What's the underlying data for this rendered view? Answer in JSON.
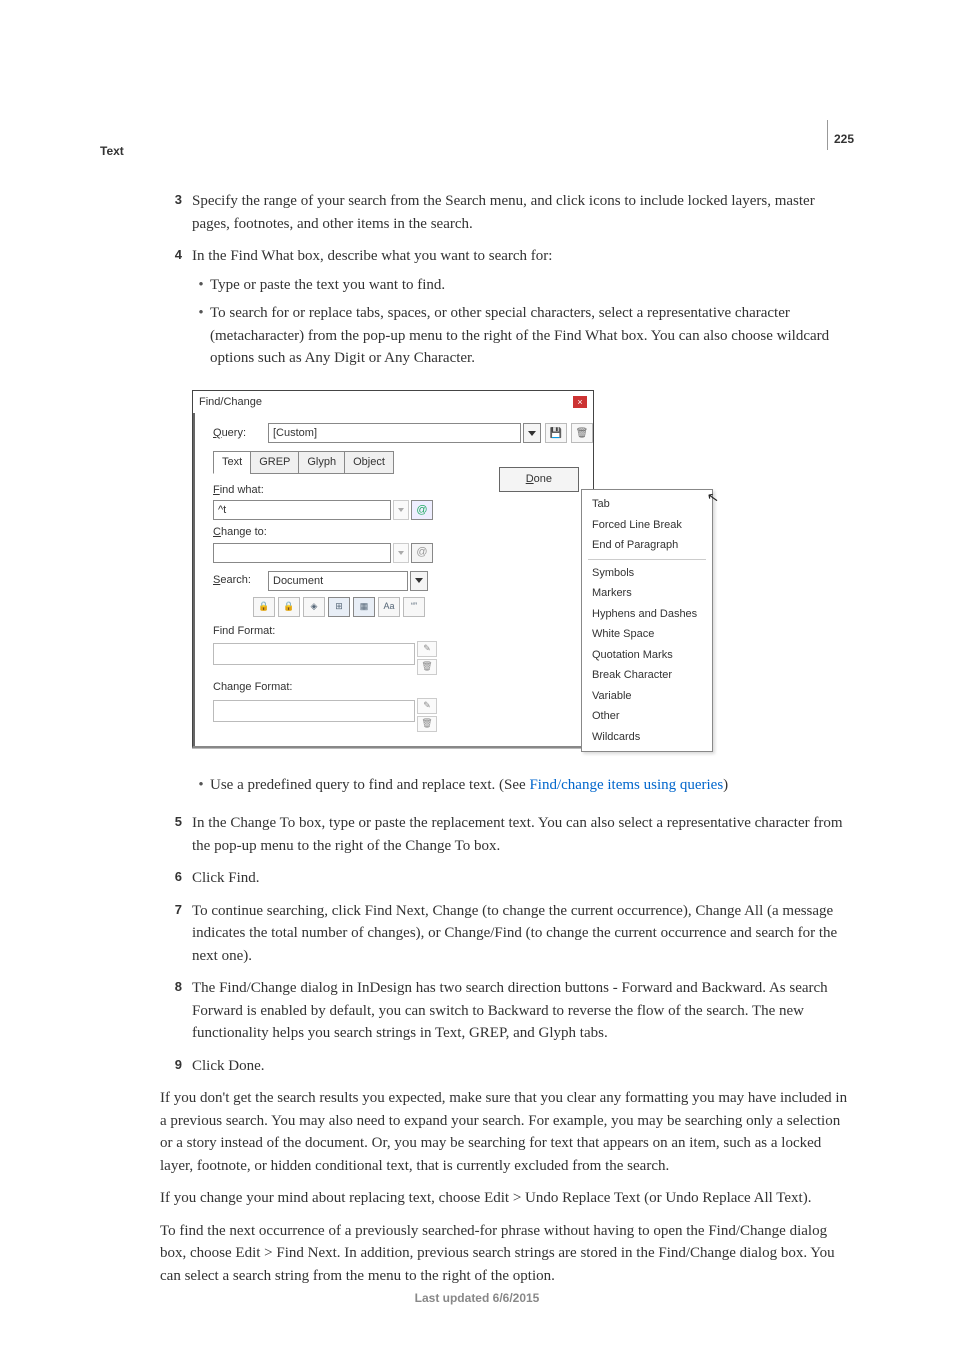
{
  "page_number": "225",
  "section_label": "Text",
  "steps": {
    "3": "Specify the range of your search from the Search menu, and click icons to include locked layers, master pages, footnotes, and other items in the search.",
    "4_lead": "In the Find What box, describe what you want to search for:",
    "4_bullets": [
      "Type or paste the text you want to find.",
      "To search for or replace tabs, spaces, or other special characters, select a representative character (metacharacter) from the pop-up menu to the right of the Find What box. You can also choose wildcard options such as Any Digit or Any Character."
    ],
    "bullet_after_image_pre": "Use a predefined query to find and replace text. (See ",
    "bullet_after_image_link": "Find/change items using queries",
    "bullet_after_image_post": ")",
    "5": "In the Change To box, type or paste the replacement text. You can also select a representative character from the pop-up menu to the right of the Change To box.",
    "6": "Click Find.",
    "7": "To continue searching, click Find Next, Change (to change the current occurrence), Change All (a message indicates the total number of changes), or Change/Find (to change the current occurrence and search for the next one).",
    "8": "The Find/Change dialog in InDesign has two search direction buttons - Forward and Backward. As search Forward is enabled by default, you can switch to Backward to reverse the flow of the search. The new functionality helps you search strings in Text, GREP, and Glyph tabs.",
    "9": "Click Done."
  },
  "paragraphs": {
    "p1": "If you don't get the search results you expected, make sure that you clear any formatting you may have included in a previous search. You may also need to expand your search. For example, you may be searching only a selection or a story instead of the document. Or, you may be searching for text that appears on an item, such as a locked layer, footnote, or hidden conditional text, that is currently excluded from the search.",
    "p2": "If you change your mind about replacing text, choose Edit > Undo Replace Text (or Undo Replace All Text).",
    "p3": "To find the next occurrence of a previously searched-for phrase without having to open the Find/Change dialog box, choose Edit > Find Next. In addition, previous search strings are stored in the Find/Change dialog box. You can select a search string from the menu to the right of the option."
  },
  "dialog": {
    "title": "Find/Change",
    "query_label": "Query:",
    "query_value": "[Custom]",
    "tabs": [
      "Text",
      "GREP",
      "Glyph",
      "Object"
    ],
    "find_what_label": "Find what:",
    "find_what_value": "^t",
    "change_to_label": "Change to:",
    "search_label": "Search:",
    "search_value": "Document",
    "find_format_label": "Find Format:",
    "change_format_label": "Change Format:",
    "done": "Done",
    "popup_items_top": [
      "Tab",
      "Forced Line Break",
      "End of Paragraph"
    ],
    "popup_items_bottom": [
      "Symbols",
      "Markers",
      "Hyphens and Dashes",
      "White Space",
      "Quotation Marks",
      "Break Character",
      "Variable",
      "Other",
      "Wildcards"
    ]
  },
  "footer": "Last updated 6/6/2015"
}
